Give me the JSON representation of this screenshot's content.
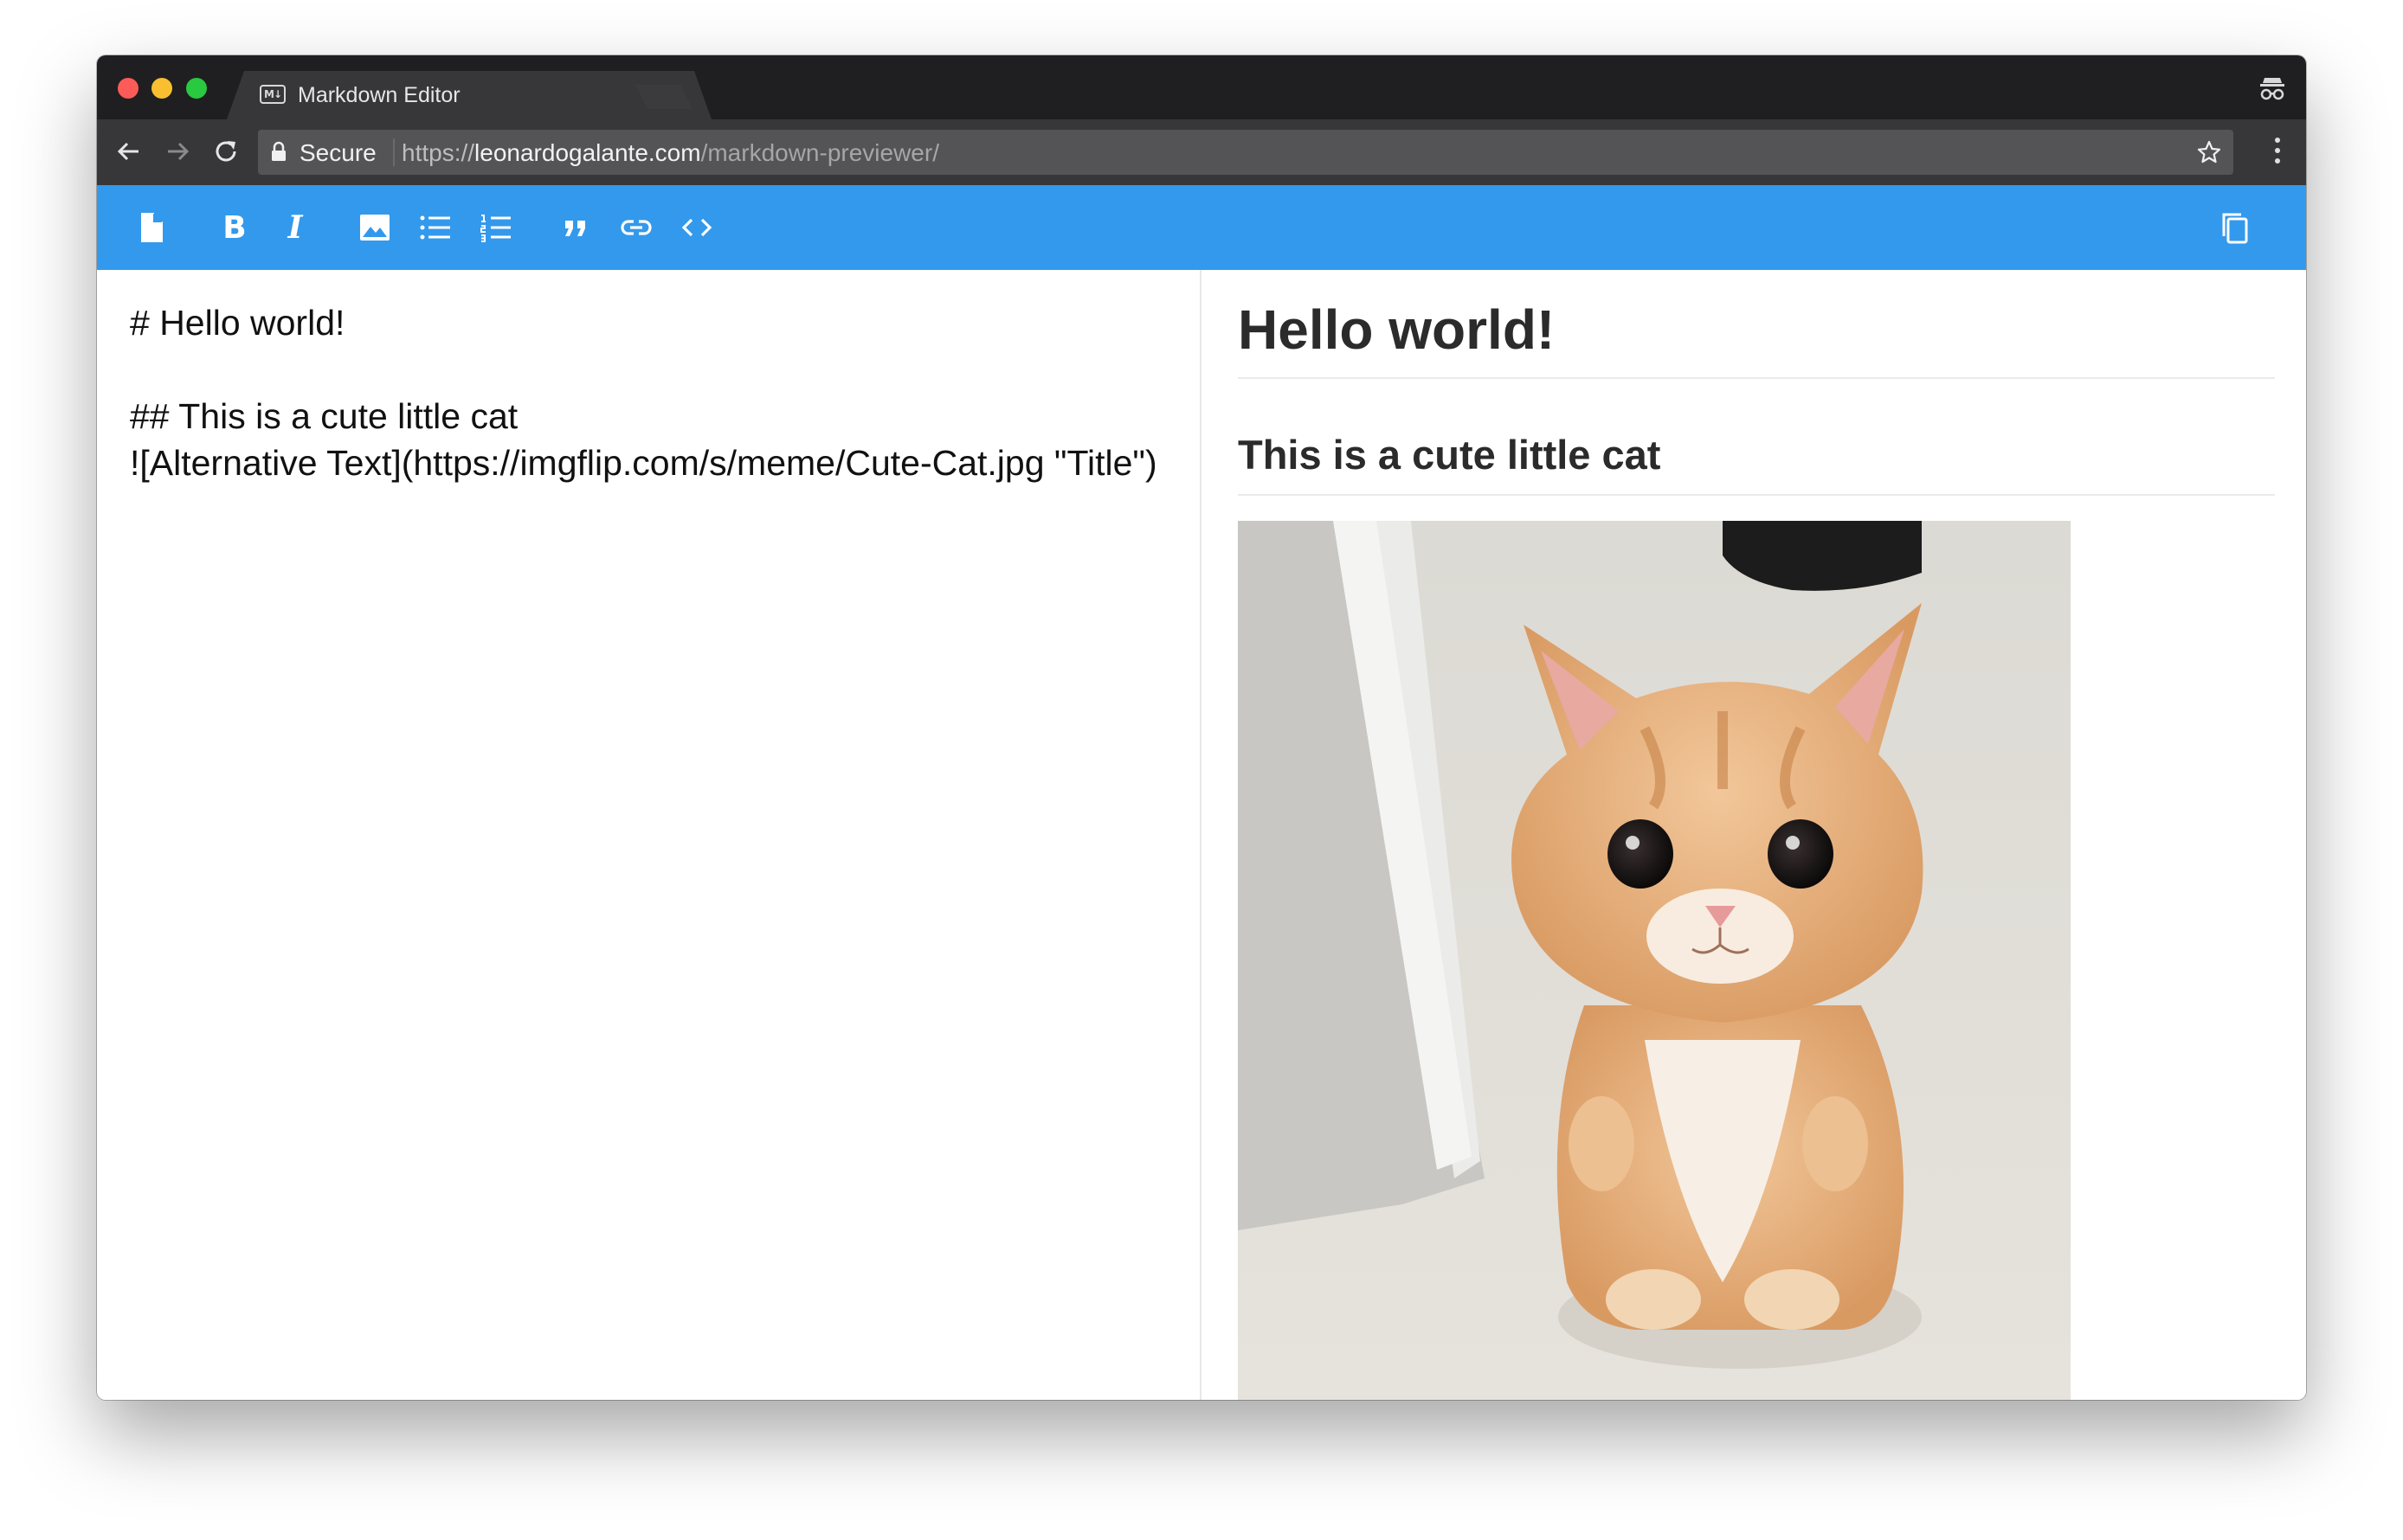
{
  "browser": {
    "tab": {
      "title": "Markdown Editor",
      "favicon_text": "M↓",
      "close_glyph": "×"
    },
    "omnibox": {
      "secure_label": "Secure",
      "url_scheme": "https://",
      "url_host": "leonardogalante.com",
      "url_path": "/markdown-previewer/"
    },
    "icons": [
      "back-icon",
      "forward-icon",
      "reload-icon",
      "lock-icon",
      "star-icon",
      "kebab-menu-icon",
      "incognito-icon"
    ]
  },
  "app_toolbar": {
    "accent_color": "#3399ec",
    "tools": [
      {
        "name": "new-document",
        "icon": "document-icon"
      },
      {
        "name": "bold",
        "icon": "bold-icon",
        "label": "B"
      },
      {
        "name": "italic",
        "icon": "italic-icon",
        "label": "I"
      },
      {
        "name": "image",
        "icon": "image-icon"
      },
      {
        "name": "bulleted-list",
        "icon": "bulleted-list-icon"
      },
      {
        "name": "numbered-list",
        "icon": "numbered-list-icon"
      },
      {
        "name": "quote",
        "icon": "quote-icon"
      },
      {
        "name": "link",
        "icon": "link-icon"
      },
      {
        "name": "code",
        "icon": "code-icon"
      },
      {
        "name": "copy",
        "icon": "copy-icon"
      }
    ]
  },
  "editor": {
    "content": "# Hello world!\n\n## This is a cute little cat\n![Alternative Text](https://imgflip.com/s/meme/Cute-Cat.jpg \"Title\")"
  },
  "preview": {
    "h1": "Hello world!",
    "h2": "This is a cute little cat",
    "image": {
      "alt": "Alternative Text",
      "title": "Title",
      "subject": "orange tabby kitten standing on hind legs"
    }
  }
}
